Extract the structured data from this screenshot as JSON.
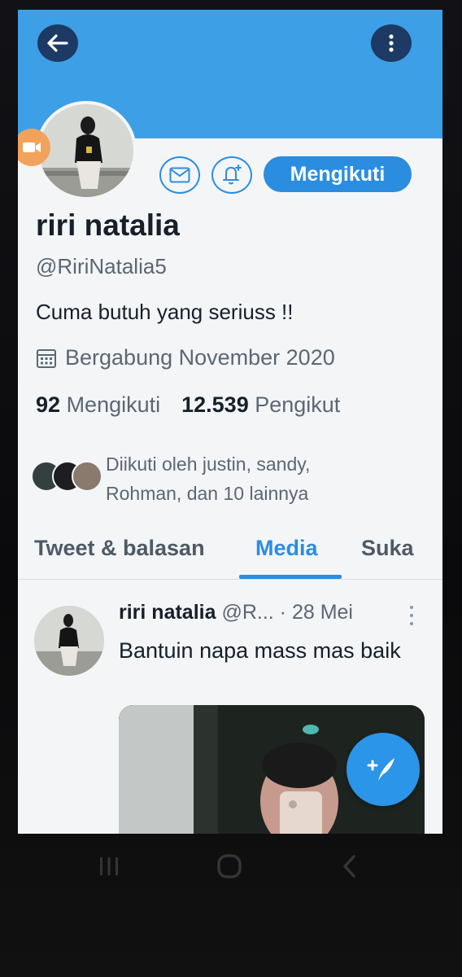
{
  "colors": {
    "banner": "#3d9fe6",
    "accent": "#2b8de0",
    "text_primary": "#17202a",
    "text_secondary": "#5b6773",
    "dark_button": "#1c3a63",
    "camera_badge": "#f2a35b"
  },
  "header": {
    "back_icon": "arrow-left-icon",
    "more_icon": "more-vertical-icon"
  },
  "profile": {
    "name": "riri natalia",
    "handle": "@RiriNatalia5",
    "bio": "Cuma butuh yang seriuss !!",
    "joined": "Bergabung November 2020",
    "following_count": "92",
    "following_label": "Mengikuti",
    "followers_count": "12.539",
    "followers_label": "Pengikut",
    "follow_button_label": "Mengikuti",
    "followed_by_line1": "Diikuti oleh justin, sandy,",
    "followed_by_line2": "Rohman, dan 10 lainnya"
  },
  "tabs": [
    {
      "label": "Tweet & balasan",
      "active": false
    },
    {
      "label": "Media",
      "active": true
    },
    {
      "label": "Suka",
      "active": false
    }
  ],
  "tweet": {
    "name": "riri natalia",
    "handle": "@R...",
    "separator": " · ",
    "date": "28 Mei",
    "text": "Bantuin napa mass mas baik"
  },
  "icons": {
    "mail": "mail-icon",
    "bell": "bell-plus-icon",
    "calendar": "calendar-icon",
    "camera": "video-camera-icon",
    "compose": "compose-tweet-icon"
  }
}
